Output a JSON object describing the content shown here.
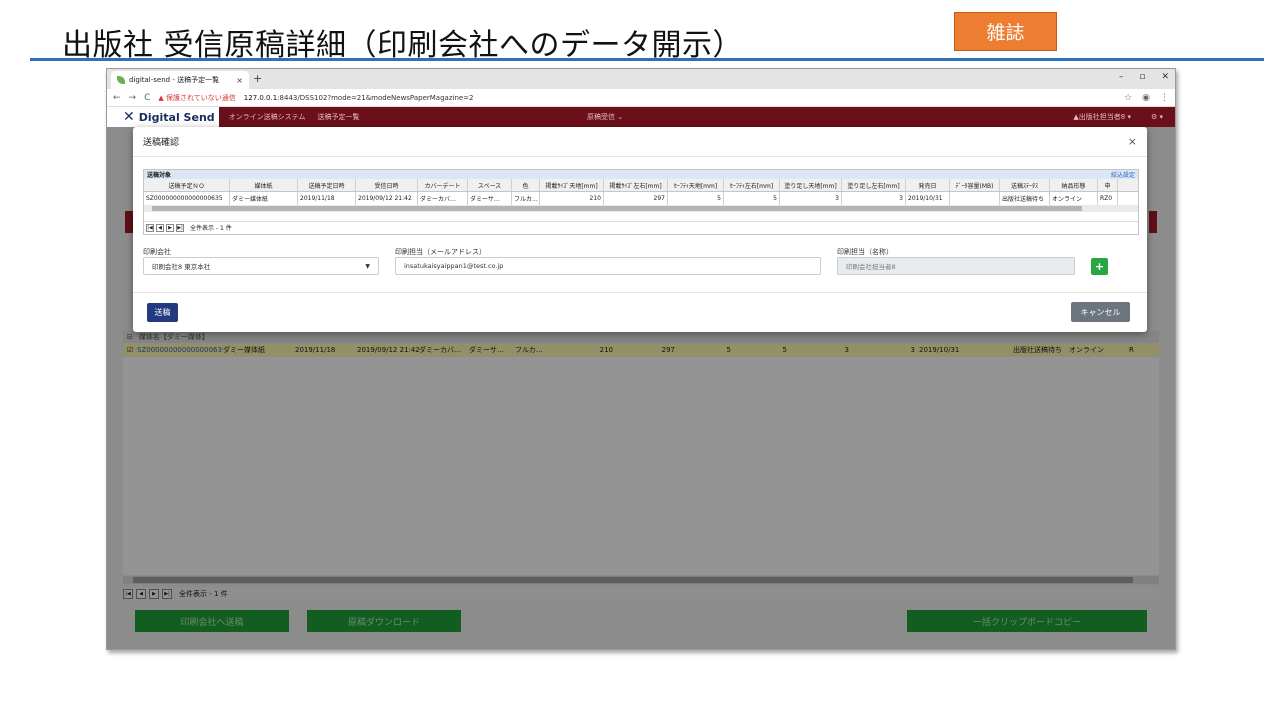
{
  "slide": {
    "title": "出版社 受信原稿詳細（印刷会社へのデータ開示）",
    "tag": "雑誌"
  },
  "browser": {
    "tab_title": "digital-send - 送稿予定一覧",
    "tab_close": "×",
    "new_tab": "+",
    "win_min": "–",
    "win_max": "▫",
    "win_close": "✕",
    "nav_back": "←",
    "nav_forward": "→",
    "nav_reload": "C",
    "security_warning": "▲ 保護されていない通信",
    "url_host": "127.0.0.1",
    "url_rest": ":8443/DSS102?mode=21&modeNewsPaperMagazine=2"
  },
  "app": {
    "logo_text": "Digital Send",
    "system_name": "オンライン送稿システム",
    "nav_item": "送稿予定一覧",
    "center_menu": "原稿受信 ⌄",
    "user_menu": "▲出版社担当者8 ▾",
    "settings_menu": "⚙ ▾"
  },
  "modal": {
    "title": "送稿確認",
    "close": "×",
    "grid_caption": "送稿対象",
    "grid_filter_link": "絞込設定",
    "columns": [
      "送稿予定ＮＯ",
      "媒体紙",
      "送稿予定日時",
      "受信日時",
      "カバーデート",
      "スペース",
      "色",
      "掲載ｻｲｽﾞ天地[mm]",
      "掲載ｻｲｽﾞ左右[mm]",
      "ｾｰﾌﾃｨ天地[mm]",
      "ｾｰﾌﾃｨ左右[mm]",
      "塗り足し天地[mm]",
      "塗り足し左右[mm]",
      "発売日",
      "ﾃﾞｰﾀ容量(MB)",
      "送稿ｽﾃｰﾀｽ",
      "納品形態",
      "申"
    ],
    "row": [
      "SZ000000000000000635",
      "ダミー媒体紙",
      "2019/11/18",
      "2019/09/12 21:42",
      "ダミーカバ…",
      "ダミーサ…",
      "フルカ…",
      "210",
      "297",
      "5",
      "5",
      "3",
      "3",
      "2019/10/31",
      "",
      "出版社送稿待ち",
      "オンライン",
      "RZ0"
    ],
    "pager_text": "全件表示 - 1 件",
    "printer_label": "印刷会社",
    "printer_value": "印刷会社8 東京本社",
    "email_label": "印刷担当（メールアドレス）",
    "email_value": "insatukaisyaippan1@test.co.jp",
    "name_label": "印刷担当（名称）",
    "name_value": "印刷会社担当者8",
    "add_label": "+",
    "send_label": "送稿",
    "cancel_label": "キャンセル"
  },
  "background": {
    "group_label": "媒体名【ダミー媒体】",
    "row": [
      "SZ000000000000000635",
      "ダミー媒体紙",
      "2019/11/18",
      "2019/09/12 21:42",
      "ダミーカバ…",
      "ダミーサ…",
      "フルカ…",
      "210",
      "297",
      "5",
      "5",
      "3",
      "3",
      "2019/10/31",
      "",
      "出版社送稿待ち",
      "オンライン",
      "R"
    ],
    "pager_text": "全件表示 - 1 件",
    "btn_send_printer": "印刷会社へ送稿",
    "btn_download": "原稿ダウンロード",
    "btn_clipboard": "一括クリップボードコピー"
  }
}
